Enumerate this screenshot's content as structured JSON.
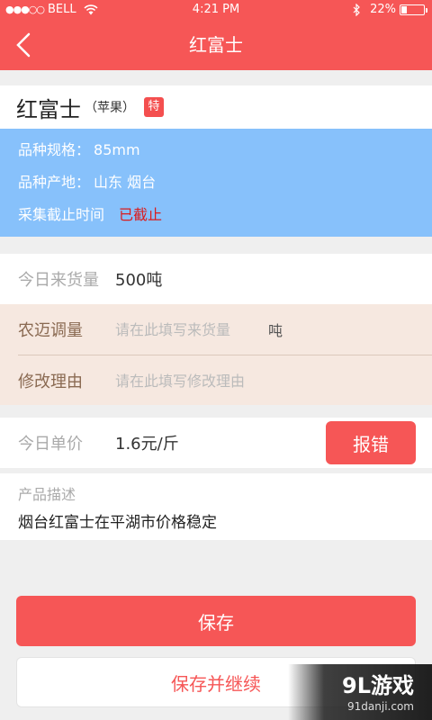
{
  "status_bar": {
    "signal": "●●●○○",
    "carrier": "BELL",
    "time": "4:21 PM",
    "battery_pct": "22%",
    "battery_level": 0.22
  },
  "nav": {
    "title": "红富士"
  },
  "product": {
    "name": "红富士",
    "type": "（苹果）",
    "badge": "特"
  },
  "info": {
    "spec_label": "品种规格：",
    "spec_value": "85mm",
    "origin_label": "品种产地：",
    "origin_value": "山东 烟台",
    "deadline_label": "采集截止时间",
    "deadline_value": "已截止"
  },
  "incoming": {
    "label": "今日来货量",
    "value": "500吨"
  },
  "adjust": {
    "qty_label": "农迈调量",
    "qty_placeholder": "请在此填写来货量",
    "unit": "吨",
    "reason_label": "修改理由",
    "reason_placeholder": "请在此填写修改理由"
  },
  "price": {
    "label": "今日单价",
    "value": "1.6元/斤",
    "report_label": "报错"
  },
  "description": {
    "label": "产品描述",
    "text": "烟台红富士在平湖市价格稳定"
  },
  "actions": {
    "save_label": "保存",
    "save_continue_label": "保存并继续"
  },
  "watermark": {
    "brand": "9L游戏",
    "site": "91danji.com"
  },
  "colors": {
    "accent": "#f65656",
    "info_bg": "#87c1fb",
    "adjust_bg": "#f6e8e0"
  }
}
